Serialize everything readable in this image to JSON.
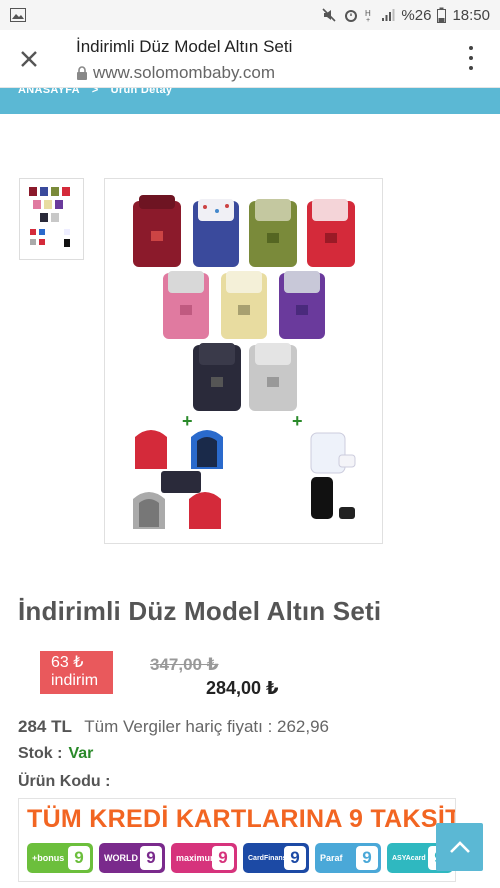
{
  "statusbar": {
    "battery": "%26",
    "time": "18:50"
  },
  "browser": {
    "title": "İndirimli Düz Model Altın Seti",
    "url": "www.solomombaby.com"
  },
  "breadcrumb": {
    "home": "ANASAYFA",
    "sep": ">",
    "current": "Ürün Detay"
  },
  "product": {
    "title": "İndirimli Düz Model Altın Seti",
    "discount_amount": "63 ₺",
    "discount_word": "indirim",
    "old_price": "347,00 ₺",
    "new_price": "284,00 ₺",
    "tl_price": "284 TL",
    "vat_text": "Tüm Vergiler hariç fiyatı : 262,96",
    "stock_label": "Stok :",
    "stock_value": "Var",
    "code_label": "Ürün Kodu :"
  },
  "banner": {
    "title": "TÜM KREDİ KARTLARINA 9 TAKSİT!",
    "cards": [
      {
        "name": "+bonus",
        "color": "#6cbf3c"
      },
      {
        "name": "WORLD",
        "color": "#7a2a8c"
      },
      {
        "name": "maximum",
        "color": "#d6337c"
      },
      {
        "name": "CardFinans",
        "color": "#1c4aa5"
      },
      {
        "name": "Paraf",
        "color": "#4aa8d8"
      },
      {
        "name": "ASYAcard",
        "color": "#2fb8c0"
      }
    ],
    "nine": "9"
  },
  "colors": {
    "accent": "#5bb8d4",
    "discount": "#e9595c",
    "stock": "#2a8a2a",
    "banner_title": "#f26522"
  }
}
